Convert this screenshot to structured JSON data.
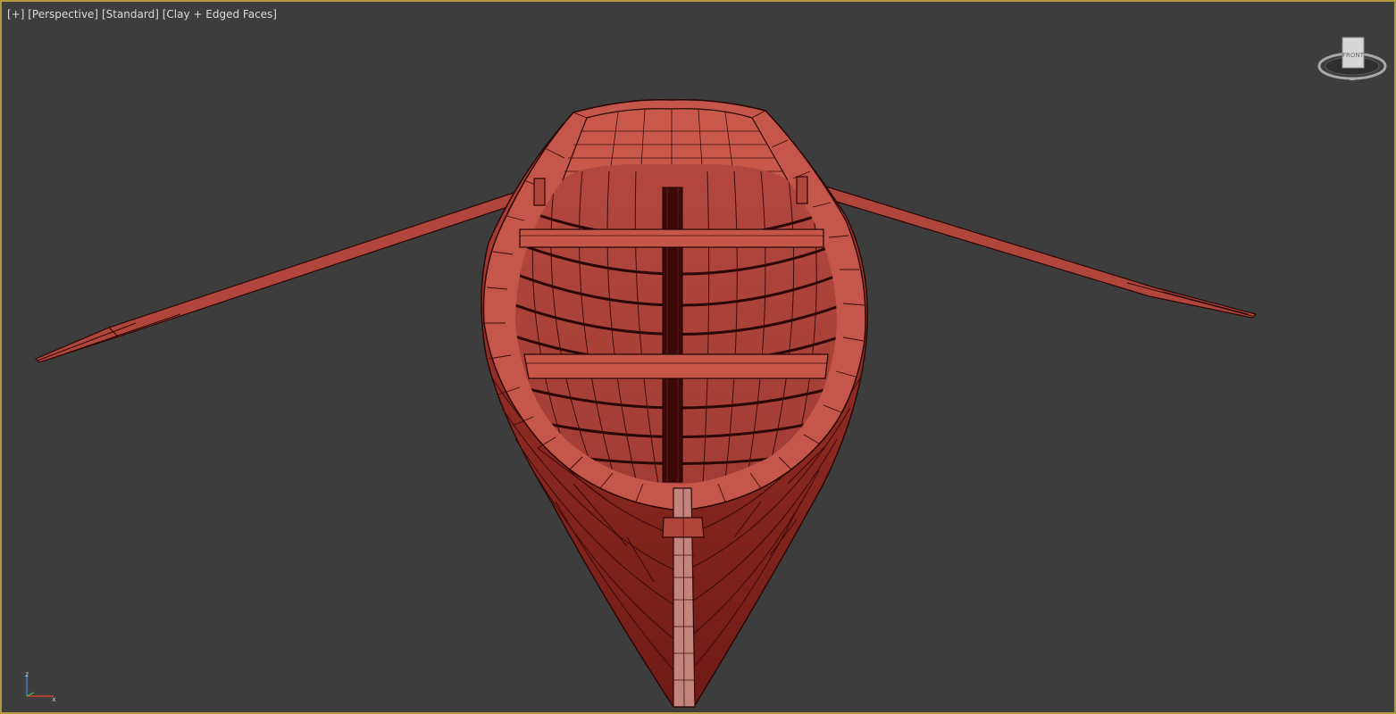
{
  "viewport": {
    "labels": {
      "menu": "[+]",
      "view": "[Perspective]",
      "shading_preset": "[Standard]",
      "shading_mode": "[Clay + Edged Faces]"
    },
    "viewcube_face": "FRONT",
    "axis": {
      "z": "z",
      "x": "x"
    }
  },
  "colors": {
    "viewport_bg": "#3d3d3d",
    "active_border": "#b29a3c",
    "clay": "#c0524a",
    "edge": "#3a0c0a"
  }
}
